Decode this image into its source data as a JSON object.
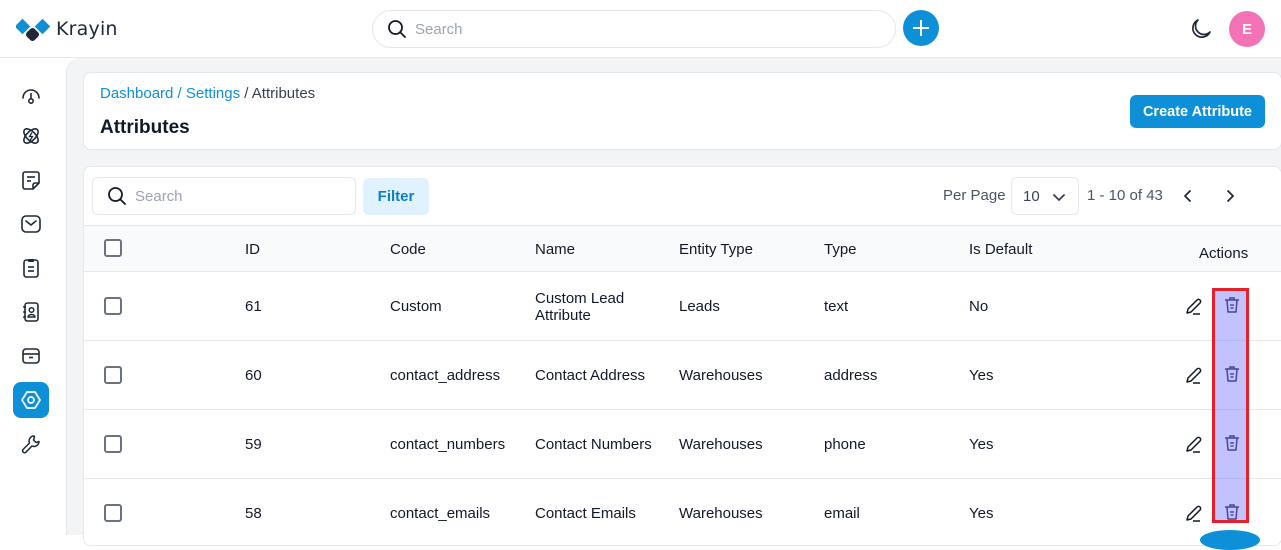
{
  "app": {
    "name": "Krayin"
  },
  "topbar": {
    "search_placeholder": "Search",
    "quick_create_icon": "plus-icon",
    "theme_toggle_icon": "moon-icon",
    "avatar_initial": "E",
    "avatar_color": "#f472b6"
  },
  "sidebar": {
    "items": [
      {
        "name": "dashboard",
        "icon": "gauge-icon",
        "active": false
      },
      {
        "name": "leads",
        "icon": "atom-icon",
        "active": false
      },
      {
        "name": "quotes",
        "icon": "sticky-note-icon",
        "active": false
      },
      {
        "name": "mail",
        "icon": "mail-icon",
        "active": false
      },
      {
        "name": "activities",
        "icon": "clipboard-icon",
        "active": false
      },
      {
        "name": "contacts",
        "icon": "contact-book-icon",
        "active": false
      },
      {
        "name": "products",
        "icon": "archive-box-icon",
        "active": false
      },
      {
        "name": "settings",
        "icon": "settings-hexagon-icon",
        "active": true
      },
      {
        "name": "configuration",
        "icon": "wrench-icon",
        "active": false
      }
    ]
  },
  "header": {
    "breadcrumb": [
      {
        "label": "Dashboard",
        "link": true
      },
      {
        "label": "Settings",
        "link": true
      },
      {
        "label": "Attributes",
        "link": false
      }
    ],
    "separator": " / ",
    "title": "Attributes",
    "create_button": "Create Attribute"
  },
  "toolbar": {
    "search_placeholder": "Search",
    "filter_label": "Filter",
    "per_page_label": "Per Page",
    "per_page_value": "10",
    "page_info": "1 - 10 of 43"
  },
  "table": {
    "columns": [
      "ID",
      "Code",
      "Name",
      "Entity Type",
      "Type",
      "Is Default",
      "Actions"
    ],
    "rows": [
      {
        "id": "61",
        "code": "Custom",
        "name": "Custom Lead Attribute",
        "entity_type": "Leads",
        "type": "text",
        "is_default": "No"
      },
      {
        "id": "60",
        "code": "contact_address",
        "name": "Contact Address",
        "entity_type": "Warehouses",
        "type": "address",
        "is_default": "Yes"
      },
      {
        "id": "59",
        "code": "contact_numbers",
        "name": "Contact Numbers",
        "entity_type": "Warehouses",
        "type": "phone",
        "is_default": "Yes"
      },
      {
        "id": "58",
        "code": "contact_emails",
        "name": "Contact Emails",
        "entity_type": "Warehouses",
        "type": "email",
        "is_default": "Yes"
      }
    ]
  },
  "colors": {
    "brand": "#0e90d9",
    "highlight_fill": "#b7b7ff",
    "highlight_border": "#e5202a"
  }
}
